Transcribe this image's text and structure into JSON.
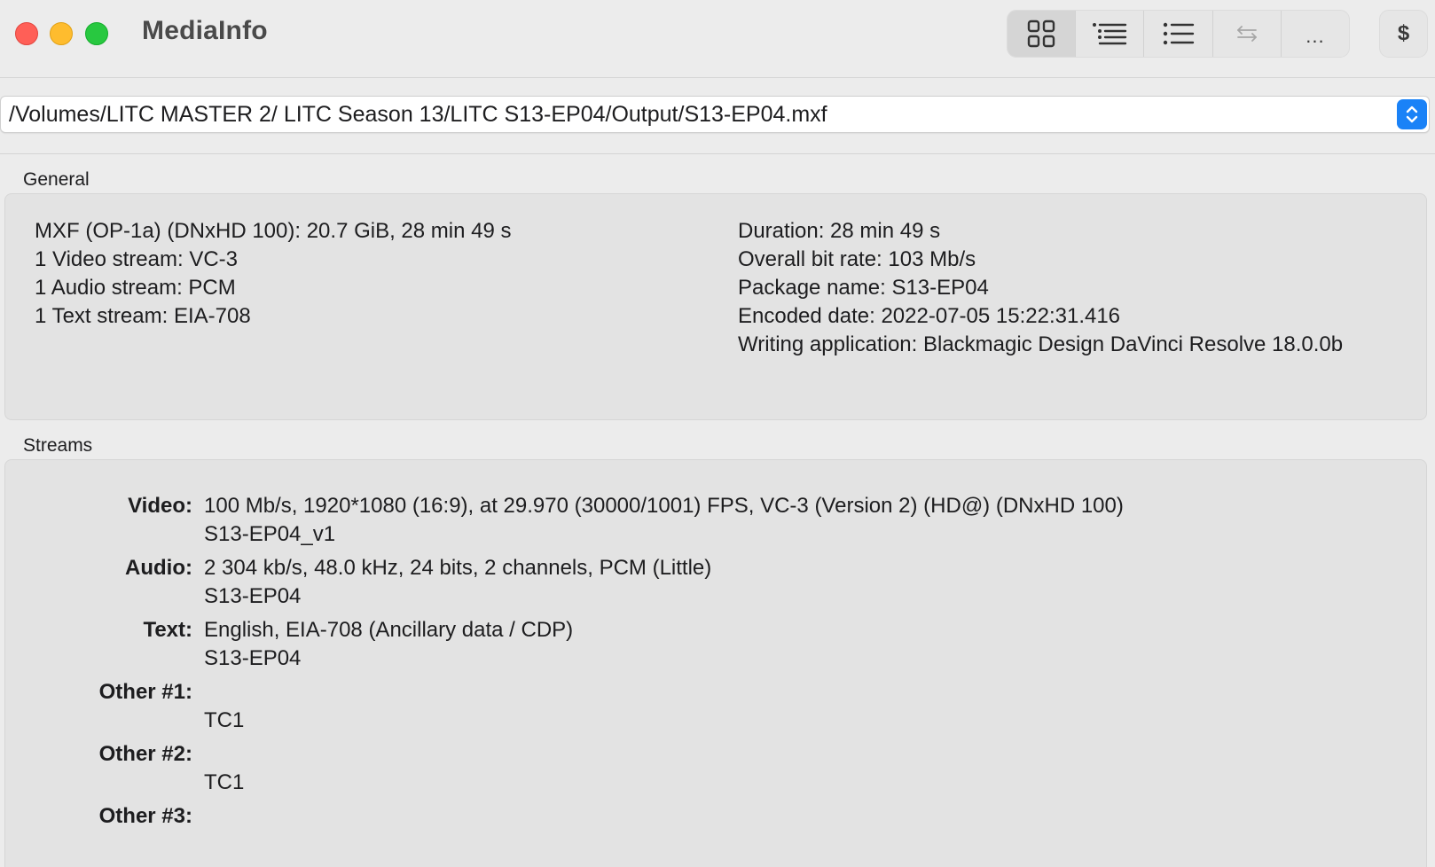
{
  "window": {
    "title": "MediaInfo"
  },
  "toolbar": {
    "buttons": [
      {
        "name": "view-grid",
        "icon": "grid-icon",
        "active": true
      },
      {
        "name": "view-tree",
        "icon": "tree-list-icon"
      },
      {
        "name": "view-text",
        "icon": "bullet-list-icon"
      },
      {
        "name": "compare",
        "icon": "swap-arrows-icon"
      },
      {
        "name": "more",
        "label": "..."
      }
    ],
    "dollar_label": "$"
  },
  "path": {
    "value": "/Volumes/LITC MASTER 2/ LITC Season 13/LITC S13-EP04/Output/S13-EP04.mxf"
  },
  "general": {
    "label": "General",
    "left": [
      "MXF (OP-1a) (DNxHD 100): 20.7 GiB, 28 min 49 s",
      "1 Video stream: VC-3",
      "1 Audio stream: PCM",
      "1 Text stream: EIA-708"
    ],
    "right": [
      "Duration: 28 min 49 s",
      "Overall bit rate: 103 Mb/s",
      "Package name: S13-EP04",
      "Encoded date: 2022-07-05 15:22:31.416",
      "Writing application: Blackmagic Design DaVinci Resolve 18.0.0b"
    ]
  },
  "streams": {
    "label": "Streams",
    "items": [
      {
        "key": "Video:",
        "line1": "100 Mb/s, 1920*1080 (16:9), at 29.970 (30000/1001) FPS, VC-3 (Version 2) (HD@) (DNxHD 100)",
        "line2": "S13-EP04_v1"
      },
      {
        "key": "Audio:",
        "line1": "2 304 kb/s, 48.0 kHz, 24 bits, 2 channels, PCM (Little)",
        "line2": "S13-EP04"
      },
      {
        "key": "Text:",
        "line1": "English, EIA-708 (Ancillary data / CDP)",
        "line2": "S13-EP04"
      },
      {
        "key": "Other #1:",
        "line1": "",
        "line2": "TC1"
      },
      {
        "key": "Other #2:",
        "line1": "",
        "line2": "TC1"
      },
      {
        "key": "Other #3:",
        "line1": "",
        "line2": ""
      }
    ]
  },
  "colors": {
    "close": "#ff5f57",
    "minimize": "#febc2e",
    "zoom": "#28c840",
    "accent": "#1a82f7"
  }
}
